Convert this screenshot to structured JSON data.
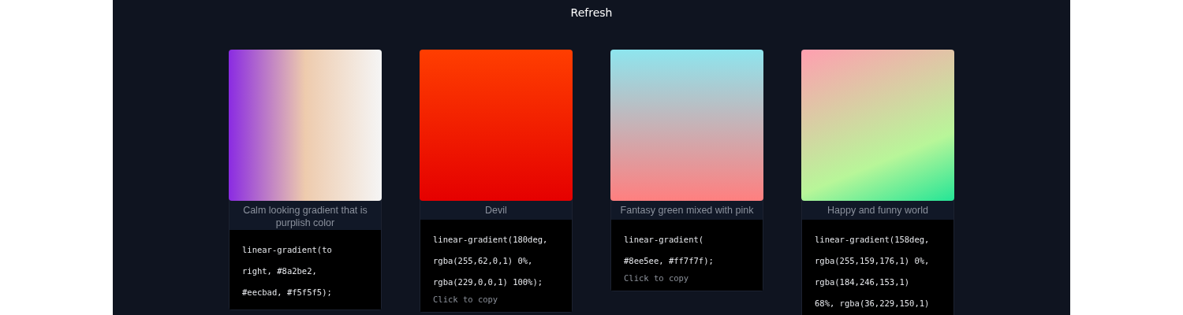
{
  "refresh_button": {
    "label": "Refresh"
  },
  "cards": [
    {
      "caption": "Calm looking gradient that is purplish color",
      "code": "linear-gradient(to right, #8a2be2, #eecbad, #f5f5f5);"
    },
    {
      "caption": "Devil",
      "code": "linear-gradient(180deg, rgba(255,62,0,1) 0%, rgba(229,0,0,1) 100%);",
      "copy_hint": "Click to copy"
    },
    {
      "caption": "Fantasy green mixed with pink",
      "code": "linear-gradient( #8ee5ee, #ff7f7f);",
      "copy_hint": "Click to copy"
    },
    {
      "caption": "Happy and funny world",
      "code": "linear-gradient(158deg, rgba(255,159,176,1) 0%, rgba(184,246,153,1) 68%, rgba(36,229,150,1)"
    }
  ]
}
